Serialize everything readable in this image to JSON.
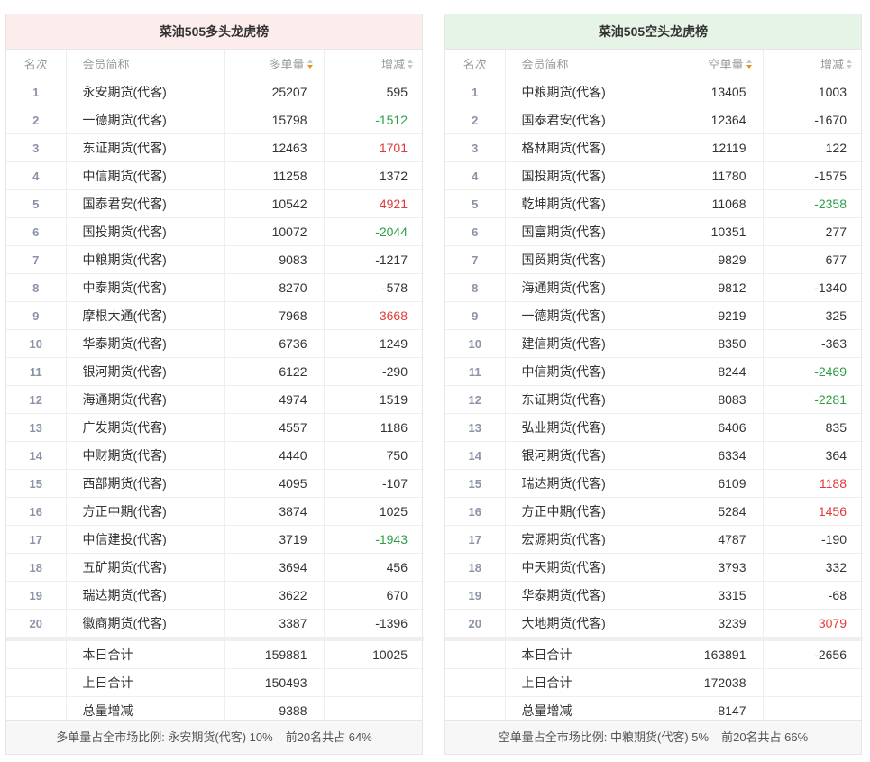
{
  "long_board": {
    "title": "菜油505多头龙虎榜",
    "headers": {
      "rank": "名次",
      "member": "会员简称",
      "volume": "多单量",
      "change": "增减"
    },
    "rows": [
      {
        "rank": "1",
        "member": "永安期货(代客)",
        "volume": "25207",
        "change": "595",
        "tone": ""
      },
      {
        "rank": "2",
        "member": "一德期货(代客)",
        "volume": "15798",
        "change": "-1512",
        "tone": "neg"
      },
      {
        "rank": "3",
        "member": "东证期货(代客)",
        "volume": "12463",
        "change": "1701",
        "tone": "pos"
      },
      {
        "rank": "4",
        "member": "中信期货(代客)",
        "volume": "11258",
        "change": "1372",
        "tone": ""
      },
      {
        "rank": "5",
        "member": "国泰君安(代客)",
        "volume": "10542",
        "change": "4921",
        "tone": "pos"
      },
      {
        "rank": "6",
        "member": "国投期货(代客)",
        "volume": "10072",
        "change": "-2044",
        "tone": "neg"
      },
      {
        "rank": "7",
        "member": "中粮期货(代客)",
        "volume": "9083",
        "change": "-1217",
        "tone": ""
      },
      {
        "rank": "8",
        "member": "中泰期货(代客)",
        "volume": "8270",
        "change": "-578",
        "tone": ""
      },
      {
        "rank": "9",
        "member": "摩根大通(代客)",
        "volume": "7968",
        "change": "3668",
        "tone": "pos"
      },
      {
        "rank": "10",
        "member": "华泰期货(代客)",
        "volume": "6736",
        "change": "1249",
        "tone": ""
      },
      {
        "rank": "11",
        "member": "银河期货(代客)",
        "volume": "6122",
        "change": "-290",
        "tone": ""
      },
      {
        "rank": "12",
        "member": "海通期货(代客)",
        "volume": "4974",
        "change": "1519",
        "tone": ""
      },
      {
        "rank": "13",
        "member": "广发期货(代客)",
        "volume": "4557",
        "change": "1186",
        "tone": ""
      },
      {
        "rank": "14",
        "member": "中财期货(代客)",
        "volume": "4440",
        "change": "750",
        "tone": ""
      },
      {
        "rank": "15",
        "member": "西部期货(代客)",
        "volume": "4095",
        "change": "-107",
        "tone": ""
      },
      {
        "rank": "16",
        "member": "方正中期(代客)",
        "volume": "3874",
        "change": "1025",
        "tone": ""
      },
      {
        "rank": "17",
        "member": "中信建投(代客)",
        "volume": "3719",
        "change": "-1943",
        "tone": "neg"
      },
      {
        "rank": "18",
        "member": "五矿期货(代客)",
        "volume": "3694",
        "change": "456",
        "tone": ""
      },
      {
        "rank": "19",
        "member": "瑞达期货(代客)",
        "volume": "3622",
        "change": "670",
        "tone": ""
      },
      {
        "rank": "20",
        "member": "徽商期货(代客)",
        "volume": "3387",
        "change": "-1396",
        "tone": ""
      }
    ],
    "summary": [
      {
        "label": "本日合计",
        "volume": "159881",
        "change": "10025"
      },
      {
        "label": "上日合计",
        "volume": "150493",
        "change": ""
      },
      {
        "label": "总量增减",
        "volume": "9388",
        "change": ""
      }
    ],
    "footer": {
      "ratio_text": "多单量占全市场比例: 永安期货(代客) 10%",
      "top20_text": "前20名共占 64%"
    }
  },
  "short_board": {
    "title": "菜油505空头龙虎榜",
    "headers": {
      "rank": "名次",
      "member": "会员简称",
      "volume": "空单量",
      "change": "增减"
    },
    "rows": [
      {
        "rank": "1",
        "member": "中粮期货(代客)",
        "volume": "13405",
        "change": "1003",
        "tone": ""
      },
      {
        "rank": "2",
        "member": "国泰君安(代客)",
        "volume": "12364",
        "change": "-1670",
        "tone": ""
      },
      {
        "rank": "3",
        "member": "格林期货(代客)",
        "volume": "12119",
        "change": "122",
        "tone": ""
      },
      {
        "rank": "4",
        "member": "国投期货(代客)",
        "volume": "11780",
        "change": "-1575",
        "tone": ""
      },
      {
        "rank": "5",
        "member": "乾坤期货(代客)",
        "volume": "11068",
        "change": "-2358",
        "tone": "neg"
      },
      {
        "rank": "6",
        "member": "国富期货(代客)",
        "volume": "10351",
        "change": "277",
        "tone": ""
      },
      {
        "rank": "7",
        "member": "国贸期货(代客)",
        "volume": "9829",
        "change": "677",
        "tone": ""
      },
      {
        "rank": "8",
        "member": "海通期货(代客)",
        "volume": "9812",
        "change": "-1340",
        "tone": ""
      },
      {
        "rank": "9",
        "member": "一德期货(代客)",
        "volume": "9219",
        "change": "325",
        "tone": ""
      },
      {
        "rank": "10",
        "member": "建信期货(代客)",
        "volume": "8350",
        "change": "-363",
        "tone": ""
      },
      {
        "rank": "11",
        "member": "中信期货(代客)",
        "volume": "8244",
        "change": "-2469",
        "tone": "neg"
      },
      {
        "rank": "12",
        "member": "东证期货(代客)",
        "volume": "8083",
        "change": "-2281",
        "tone": "neg"
      },
      {
        "rank": "13",
        "member": "弘业期货(代客)",
        "volume": "6406",
        "change": "835",
        "tone": ""
      },
      {
        "rank": "14",
        "member": "银河期货(代客)",
        "volume": "6334",
        "change": "364",
        "tone": ""
      },
      {
        "rank": "15",
        "member": "瑞达期货(代客)",
        "volume": "6109",
        "change": "1188",
        "tone": "pos"
      },
      {
        "rank": "16",
        "member": "方正中期(代客)",
        "volume": "5284",
        "change": "1456",
        "tone": "pos"
      },
      {
        "rank": "17",
        "member": "宏源期货(代客)",
        "volume": "4787",
        "change": "-190",
        "tone": ""
      },
      {
        "rank": "18",
        "member": "中天期货(代客)",
        "volume": "3793",
        "change": "332",
        "tone": ""
      },
      {
        "rank": "19",
        "member": "华泰期货(代客)",
        "volume": "3315",
        "change": "-68",
        "tone": ""
      },
      {
        "rank": "20",
        "member": "大地期货(代客)",
        "volume": "3239",
        "change": "3079",
        "tone": "pos"
      }
    ],
    "summary": [
      {
        "label": "本日合计",
        "volume": "163891",
        "change": "-2656"
      },
      {
        "label": "上日合计",
        "volume": "172038",
        "change": ""
      },
      {
        "label": "总量增减",
        "volume": "-8147",
        "change": ""
      }
    ],
    "footer": {
      "ratio_text": "空单量占全市场比例: 中粮期货(代客) 5%",
      "top20_text": "前20名共占 66%"
    }
  },
  "colors": {
    "positive": "#e03b3b",
    "negative": "#2e9e46",
    "long_header_bg": "#fdecec",
    "short_header_bg": "#e6f4e8",
    "sort_active": "#f08a24"
  },
  "icons": {
    "sort_active": "sort-desc-icon",
    "sort_inactive": "sort-icon"
  }
}
